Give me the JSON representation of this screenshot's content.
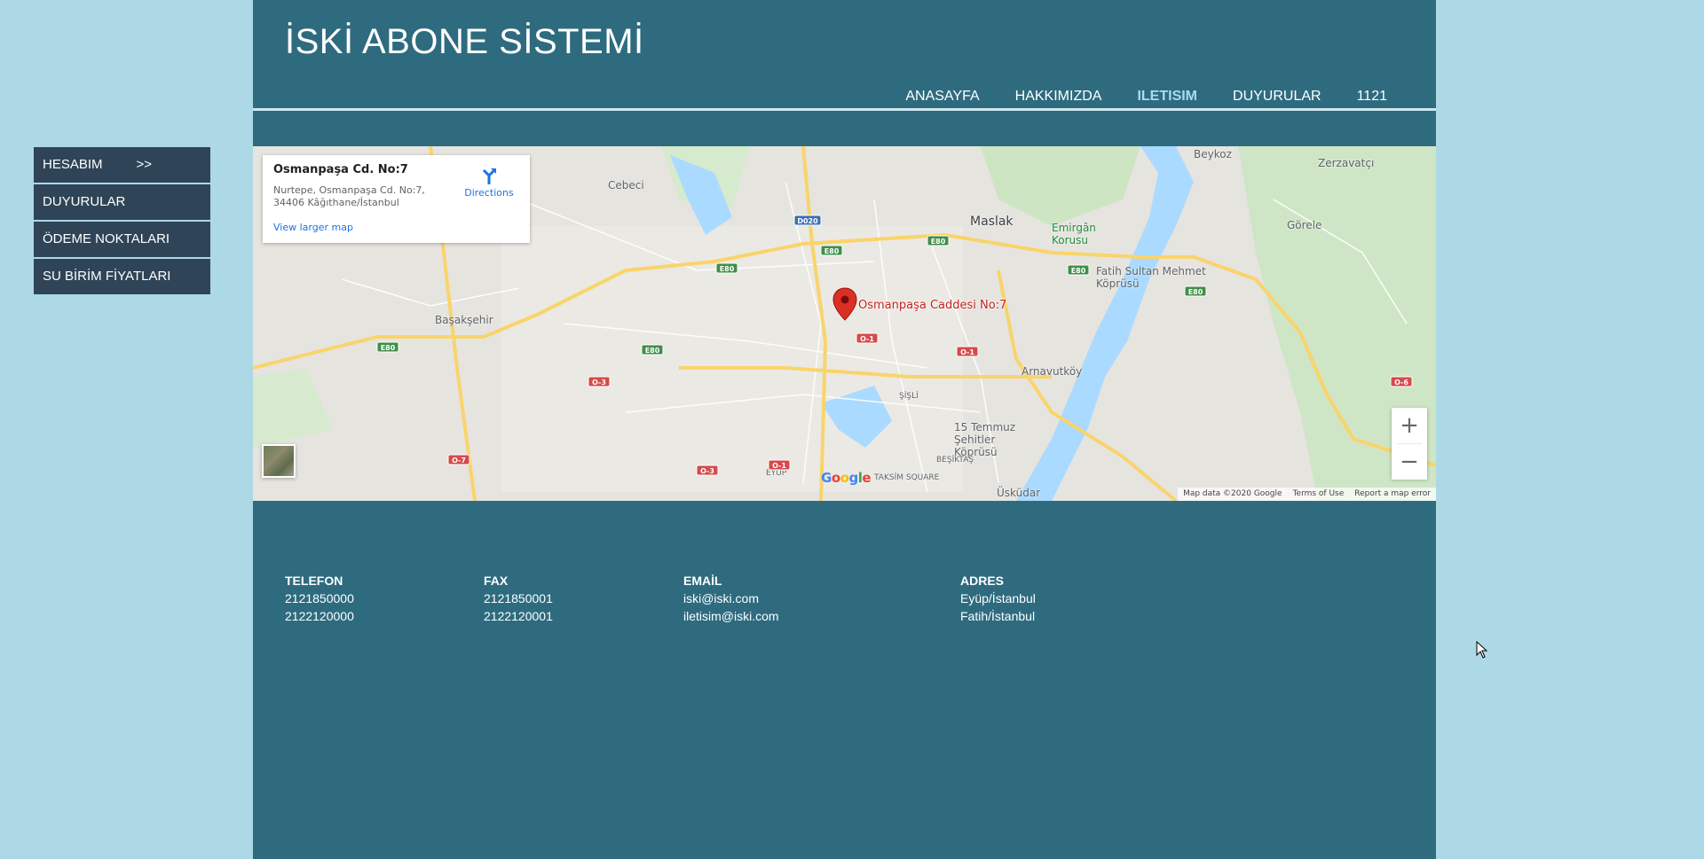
{
  "sidebar": {
    "items": [
      {
        "label": "HESABIM",
        "suffix": ">>"
      },
      {
        "label": "DUYURULAR"
      },
      {
        "label": "ÖDEME NOKTALARI"
      },
      {
        "label": "SU BİRİM FİYATLARI"
      }
    ]
  },
  "header": {
    "title": "İSKİ ABONE SİSTEMİ",
    "nav": [
      "ANASAYFA",
      "HAKKIMIZDA",
      "ILETISIM",
      "DUYURULAR",
      "1121"
    ],
    "active_nav": "ILETISIM"
  },
  "map": {
    "card": {
      "title": "Osmanpaşa Cd. No:7",
      "address_line1": "Nurtepe, Osmanpaşa Cd. No:7,",
      "address_line2": "34406 Kâğıthane/İstanbul",
      "larger_map": "View larger map",
      "directions": "Directions"
    },
    "pin_label": "Osmanpaşa Caddesi No:7",
    "places": [
      "Beykoz",
      "Zerzavatçı",
      "Cebeci",
      "Maslak",
      "Emirgân Korusu",
      "Görele",
      "Fatih Sultan Mehmet Köprüsü",
      "Başakşehir",
      "Arnavutköy",
      "ŞİŞLİ",
      "15 Temmuz Şehitler Köprüsü",
      "BEŞİKTAŞ",
      "EYÜP",
      "TAKSİM SQUARE",
      "Üsküdar"
    ],
    "road_badges": [
      "D020",
      "E80",
      "E80",
      "E80",
      "E80",
      "E80",
      "E80",
      "E80",
      "O-1",
      "O-1",
      "O-1",
      "O-3",
      "O-3",
      "O-6",
      "O-7"
    ],
    "footer": {
      "data": "Map data ©2020 Google",
      "terms": "Terms of Use",
      "report": "Report a map error"
    },
    "zoom_in": "+",
    "zoom_out": "−",
    "logo": "Google"
  },
  "contact": {
    "telefon": {
      "head": "TELEFON",
      "lines": [
        "2121850000",
        "2122120000"
      ]
    },
    "fax": {
      "head": "FAX",
      "lines": [
        "2121850001",
        "2122120001"
      ]
    },
    "email": {
      "head": "EMAİL",
      "lines": [
        "iski@iski.com",
        "iletisim@iski.com"
      ]
    },
    "adres": {
      "head": "ADRES",
      "lines": [
        "Eyüp/İstanbul",
        "Fatih/İstanbul"
      ]
    }
  },
  "colors": {
    "page_bg": "#add8e6",
    "main_bg": "#2e6b7f",
    "sidebar_bg": "#2f4457",
    "nav_active": "#a8dcef",
    "pin": "#d93025"
  }
}
